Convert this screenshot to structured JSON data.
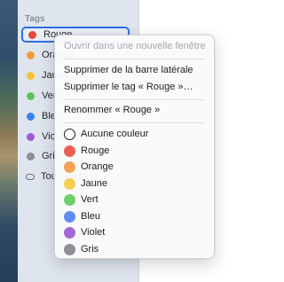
{
  "sidebar": {
    "section_title": "Tags",
    "items": [
      {
        "label": "Rouge",
        "color": "#e5483e"
      },
      {
        "label": "Orange",
        "color": "#f19a38"
      },
      {
        "label": "Jaune",
        "color": "#f4c532"
      },
      {
        "label": "Vert",
        "color": "#5ec453"
      },
      {
        "label": "Bleu",
        "color": "#3b82f0"
      },
      {
        "label": "Violet",
        "color": "#a259d9"
      },
      {
        "label": "Gris",
        "color": "#8e8e93"
      },
      {
        "label": "Tous les tags…"
      }
    ]
  },
  "context_menu": {
    "open_new_window": "Ouvrir dans une nouvelle fenêtre",
    "remove_from_sidebar": "Supprimer de la barre latérale",
    "delete_tag": "Supprimer le tag « Rouge »…",
    "rename_tag": "Renommer « Rouge »",
    "colors": [
      {
        "label": "Aucune couleur",
        "color": "none"
      },
      {
        "label": "Rouge",
        "color": "#ec5f54"
      },
      {
        "label": "Orange",
        "color": "#f2a159"
      },
      {
        "label": "Jaune",
        "color": "#f6cf52"
      },
      {
        "label": "Vert",
        "color": "#6fcf6a"
      },
      {
        "label": "Bleu",
        "color": "#5f8cf0"
      },
      {
        "label": "Violet",
        "color": "#a467d8"
      },
      {
        "label": "Gris",
        "color": "#8f8f93"
      }
    ]
  }
}
